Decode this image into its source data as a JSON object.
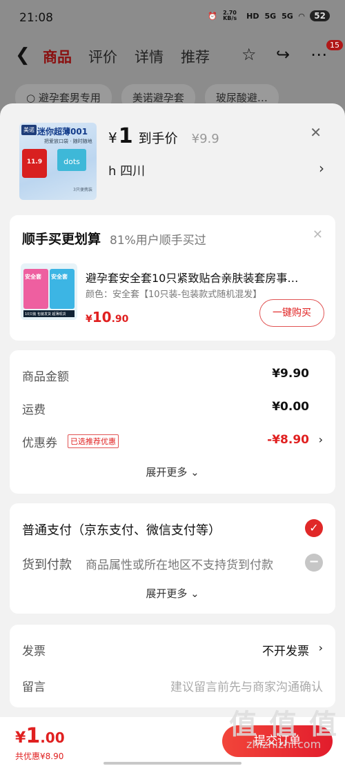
{
  "statusbar": {
    "time": "21:08",
    "net_speed": "2.70 KB/s",
    "hd": "HD",
    "sig1": "5G",
    "sig2": "5G",
    "battery": "52"
  },
  "navbar": {
    "tabs": [
      {
        "label": "商品"
      },
      {
        "label": "评价"
      },
      {
        "label": "详情"
      },
      {
        "label": "推荐"
      }
    ],
    "badge": "15"
  },
  "chips": [
    "避孕套男专用",
    "美诺避孕套",
    "玻尿酸避…"
  ],
  "product": {
    "image_texts": {
      "brand": "美诺",
      "title": "迷你超薄001",
      "sub": "把爱放口袋 · 随时随地",
      "price_tag": "11.9",
      "box_text": "dots",
      "foot": "3只便携装"
    },
    "price_yen": "¥",
    "price_int": "1",
    "price_label": "到手价",
    "original_price": "¥9.9",
    "address": "h  四川"
  },
  "upsell": {
    "title": "顺手买更划算",
    "subtitle": "81%用户顺手买过",
    "item_name": "避孕套安全套10只紧致贴合亲肤装套房事…",
    "item_spec": "颜色：安全套【10只装-包装款式随机混发】",
    "thumb_texts": {
      "left": "安全套",
      "right": "安全套",
      "strip": "10只装 包装发货 超薄现货"
    },
    "price_yen": "¥",
    "price_int": "10",
    "price_dec": ".90",
    "buy_label": "一键购买"
  },
  "summary": {
    "rows": [
      {
        "label": "商品金额",
        "value": "¥9.90"
      },
      {
        "label": "运费",
        "value": "¥0.00"
      },
      {
        "label": "优惠券",
        "tag": "已选推荐优惠",
        "value": "-¥8.90"
      }
    ],
    "more": "展开更多 ⌄"
  },
  "payment": {
    "options": [
      {
        "label": "普通支付（京东支付、微信支付等）"
      },
      {
        "label": "货到付款",
        "note": "商品属性或所在地区不支持货到付款"
      }
    ],
    "more": "展开更多 ⌄"
  },
  "invoice": {
    "label": "发票",
    "value": "不开发票",
    "message_label": "留言",
    "message_placeholder": "建议留言前先与商家沟通确认"
  },
  "bottom": {
    "total_yen": "¥",
    "total_int": "1",
    "total_dec": ".00",
    "saved": "共优惠¥8.90",
    "submit": "提交订单"
  },
  "watermark": {
    "big": "值 值 值",
    "small": "zhizhizhi.com"
  },
  "colors": {
    "accent": "#e02020",
    "brand_dark": "#8a0f0f"
  }
}
